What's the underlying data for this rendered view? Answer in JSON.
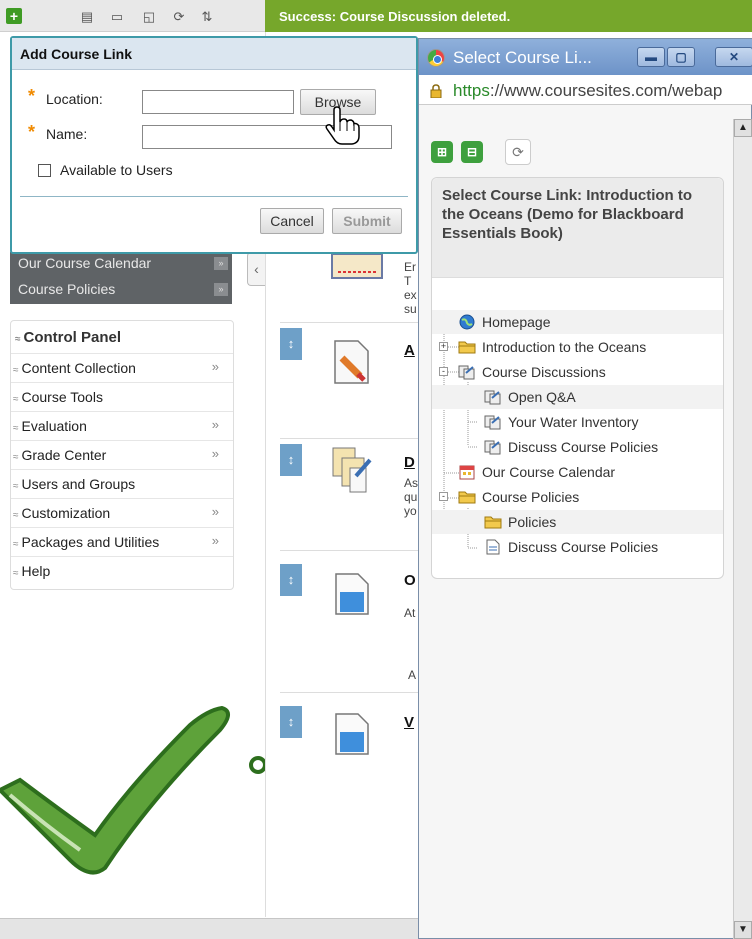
{
  "toolbar": {
    "add_symbol": "+",
    "notification": "Success: Course Discussion deleted."
  },
  "course_menu": {
    "items": [
      {
        "label": "Our Course Calendar"
      },
      {
        "label": "Course Policies"
      }
    ]
  },
  "control_panel": {
    "title": "Control Panel",
    "items": [
      {
        "label": "Content Collection",
        "more": "»"
      },
      {
        "label": "Course Tools",
        "more": ""
      },
      {
        "label": "Evaluation",
        "more": "»"
      },
      {
        "label": "Grade Center",
        "more": "»"
      },
      {
        "label": "Users and Groups",
        "more": ""
      },
      {
        "label": "Customization",
        "more": "»"
      },
      {
        "label": "Packages and Utilities",
        "more": "»"
      },
      {
        "label": "Help",
        "more": ""
      }
    ]
  },
  "add_link_panel": {
    "title": "Add Course Link",
    "location_label": "Location:",
    "location_value": "",
    "browse_label": "Browse",
    "name_label": "Name:",
    "name_value": "",
    "available_label": "Available to Users",
    "available_checked": false,
    "cancel_label": "Cancel",
    "submit_label": "Submit"
  },
  "content_items": [
    {
      "title": "",
      "lines": [
        "Er",
        "T",
        "ex",
        "su"
      ]
    },
    {
      "title": "A",
      "lines": []
    },
    {
      "title": "D",
      "lines": [
        "As",
        "qu",
        "yo"
      ]
    },
    {
      "title": "O",
      "lines": [
        "At",
        "",
        "",
        "A"
      ]
    },
    {
      "title": "V",
      "lines": []
    }
  ],
  "popup": {
    "window_title": "Select Course Li...",
    "url_scheme": "https",
    "url_rest": "://www.coursesites.com/webap",
    "header": "Select Course Link: Introduction to the Oceans (Demo for Blackboard Essentials Book)",
    "tree": [
      {
        "label": "Homepage",
        "icon": "globe-icon",
        "indent": 0,
        "highlight": true
      },
      {
        "label": "Introduction to the Oceans",
        "icon": "folder-icon",
        "indent": 0,
        "highlight": false,
        "expander": "+"
      },
      {
        "label": "Course Discussions",
        "icon": "discussion-icon",
        "indent": 0,
        "highlight": false,
        "expander": "-"
      },
      {
        "label": "Open Q&A",
        "icon": "discussion-icon",
        "indent": 1,
        "highlight": true
      },
      {
        "label": "Your Water Inventory",
        "icon": "discussion-icon",
        "indent": 1,
        "highlight": false
      },
      {
        "label": "Discuss Course Policies",
        "icon": "discussion-icon",
        "indent": 1,
        "highlight": false
      },
      {
        "label": "Our Course Calendar",
        "icon": "calendar-icon",
        "indent": 0,
        "highlight": false
      },
      {
        "label": "Course Policies",
        "icon": "folder-icon",
        "indent": 0,
        "highlight": false,
        "expander": "-"
      },
      {
        "label": "Policies",
        "icon": "folder-icon",
        "indent": 1,
        "highlight": true
      },
      {
        "label": "Discuss Course Policies",
        "icon": "document-icon",
        "indent": 1,
        "highlight": false
      }
    ]
  },
  "colors": {
    "success_green": "#76a72b",
    "accent_blue": "#6ea0c8",
    "panel_border": "#3e9aa8",
    "required_orange": "#f08a00"
  }
}
